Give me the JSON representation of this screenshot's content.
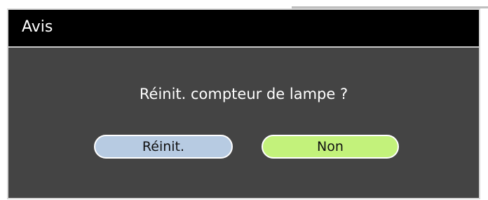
{
  "dialog": {
    "title": "Avis",
    "message": "Réinit. compteur de lampe ?",
    "buttons": {
      "reset_label": "Réinit.",
      "no_label": "Non"
    }
  },
  "colors": {
    "titlebar": "#000000",
    "body": "#444444",
    "reset_button": "#b7cbe2",
    "no_button": "#c3f27b"
  }
}
